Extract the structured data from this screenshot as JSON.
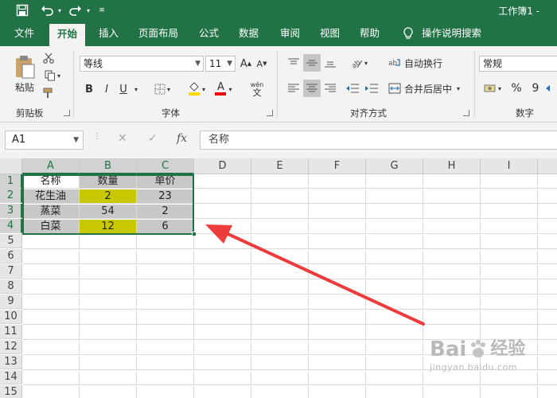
{
  "window": {
    "title": "工作簿1 -"
  },
  "qat": {
    "save_icon": "save-icon",
    "undo_icon": "undo-icon",
    "redo_icon": "redo-icon",
    "more_icon": "customize-icon"
  },
  "tabs": [
    {
      "label": "文件",
      "active": false
    },
    {
      "label": "开始",
      "active": true
    },
    {
      "label": "插入",
      "active": false
    },
    {
      "label": "页面布局",
      "active": false
    },
    {
      "label": "公式",
      "active": false
    },
    {
      "label": "数据",
      "active": false
    },
    {
      "label": "审阅",
      "active": false
    },
    {
      "label": "视图",
      "active": false
    },
    {
      "label": "帮助",
      "active": false
    },
    {
      "label": "操作说明搜索",
      "active": false
    }
  ],
  "ribbon": {
    "clipboard": {
      "label": "剪贴板",
      "paste_label": "粘贴"
    },
    "font": {
      "label": "字体",
      "font_name": "等线",
      "font_size": "11",
      "bold": "B",
      "italic": "I",
      "underline": "U",
      "grow": "A",
      "shrink": "A",
      "color_a": "A",
      "wen": "wén",
      "wen2": "文"
    },
    "alignment": {
      "label": "对齐方式",
      "wrap_text": "自动换行",
      "merge_center": "合并后居中"
    },
    "number": {
      "label": "数字",
      "format": "常规",
      "percent": "%",
      "comma": "9"
    }
  },
  "formula_bar": {
    "name_box": "A1",
    "fx": "fx",
    "cancel": "✕",
    "enter": "✓",
    "content": "名称"
  },
  "sheet": {
    "columns": [
      "A",
      "B",
      "C",
      "D",
      "E",
      "F",
      "G",
      "H",
      "I"
    ],
    "rows": [
      "1",
      "2",
      "3",
      "4",
      "5",
      "6",
      "7",
      "8",
      "9",
      "10",
      "11",
      "12",
      "13",
      "14",
      "15"
    ],
    "table": [
      [
        "名称",
        "数量",
        "单价"
      ],
      [
        "花生油",
        "2",
        "23"
      ],
      [
        "蒸菜",
        "54",
        "2"
      ],
      [
        "白菜",
        "12",
        "6"
      ]
    ],
    "cell_colors": {
      "selection_gray": "#c8c8c8",
      "highlight_yellow": "#c8c800",
      "active_cell": "#ffffff"
    },
    "highlighted_cells": [
      "B2",
      "B4"
    ]
  },
  "annotation": {
    "arrow_color": "#ee3b3b"
  },
  "watermark": {
    "brand": "Bai",
    "brand2": "经验",
    "url": "jingyan.baidu.com"
  },
  "colors": {
    "excel_green": "#217346"
  }
}
